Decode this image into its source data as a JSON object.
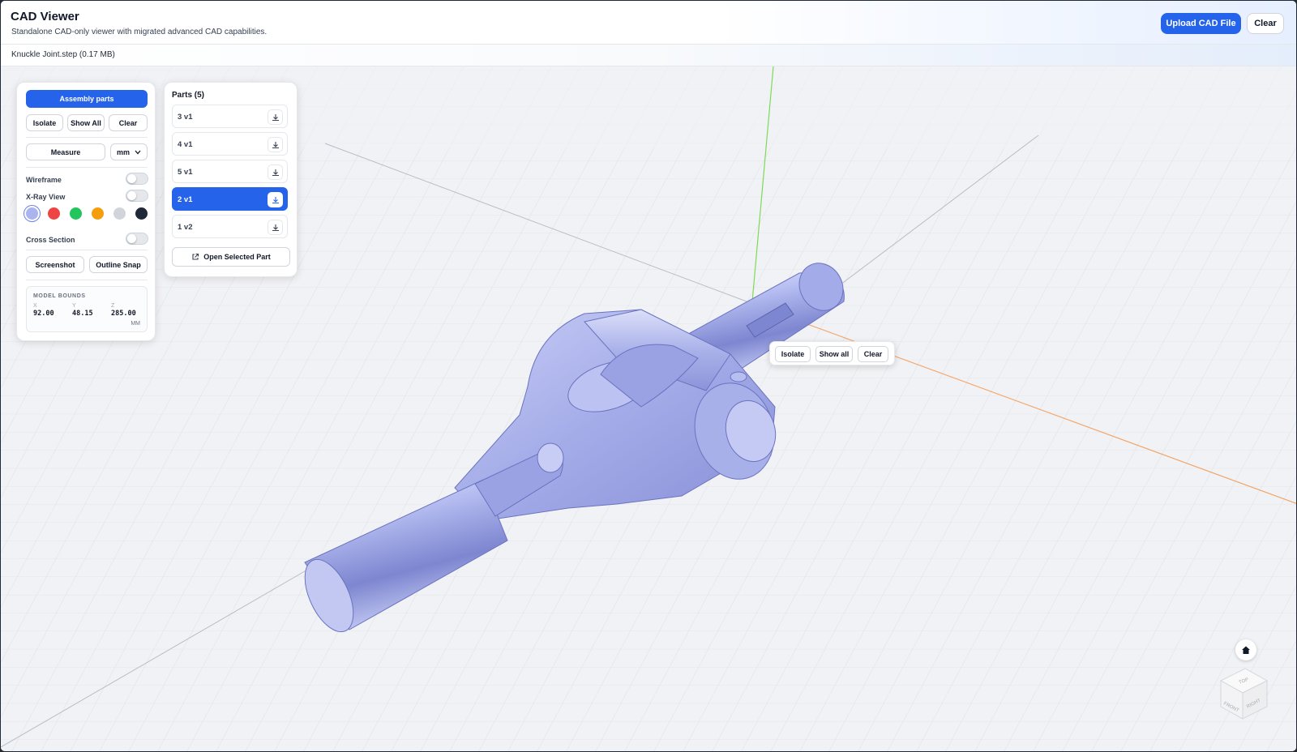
{
  "header": {
    "title": "CAD Viewer",
    "subtitle": "Standalone CAD-only viewer with migrated advanced CAD capabilities.",
    "upload_label": "Upload CAD File",
    "clear_label": "Clear"
  },
  "file": {
    "label": "Knuckle Joint.step (0.17 MB)"
  },
  "tools": {
    "assembly_label": "Assembly parts",
    "isolate_label": "Isolate",
    "show_all_label": "Show All",
    "clear_label": "Clear",
    "measure_label": "Measure",
    "unit_value": "mm",
    "wireframe_label": "Wireframe",
    "wireframe_on": false,
    "xray_label": "X-Ray View",
    "xray_on": false,
    "colors": [
      "#aab4ee",
      "#ef4444",
      "#22c55e",
      "#f59e0b",
      "#d1d5db",
      "#1f2937"
    ],
    "selected_color": "#aab4ee",
    "cross_section_label": "Cross Section",
    "cross_section_on": false,
    "screenshot_label": "Screenshot",
    "outline_snap_label": "Outline Snap",
    "bounds": {
      "title": "MODEL BOUNDS",
      "x_label": "X",
      "x_value": "92.00",
      "y_label": "Y",
      "y_value": "48.15",
      "z_label": "Z",
      "z_value": "285.00",
      "unit": "MM"
    }
  },
  "parts": {
    "title": "Parts (5)",
    "items": [
      {
        "label": "3 v1",
        "selected": false
      },
      {
        "label": "4 v1",
        "selected": false
      },
      {
        "label": "5 v1",
        "selected": false
      },
      {
        "label": "2 v1",
        "selected": true
      },
      {
        "label": "1 v2",
        "selected": false
      }
    ],
    "open_label": "Open Selected Part"
  },
  "context_menu": {
    "isolate_label": "Isolate",
    "show_all_label": "Show all",
    "clear_label": "Clear"
  },
  "view_cube": {
    "top": "TOP",
    "front": "FRONT",
    "right": "RIGHT"
  },
  "colors": {
    "accent": "#2563eb",
    "model": "#9aa3e6",
    "axis_y": "#7ed957",
    "axis_x": "#f4a261"
  }
}
